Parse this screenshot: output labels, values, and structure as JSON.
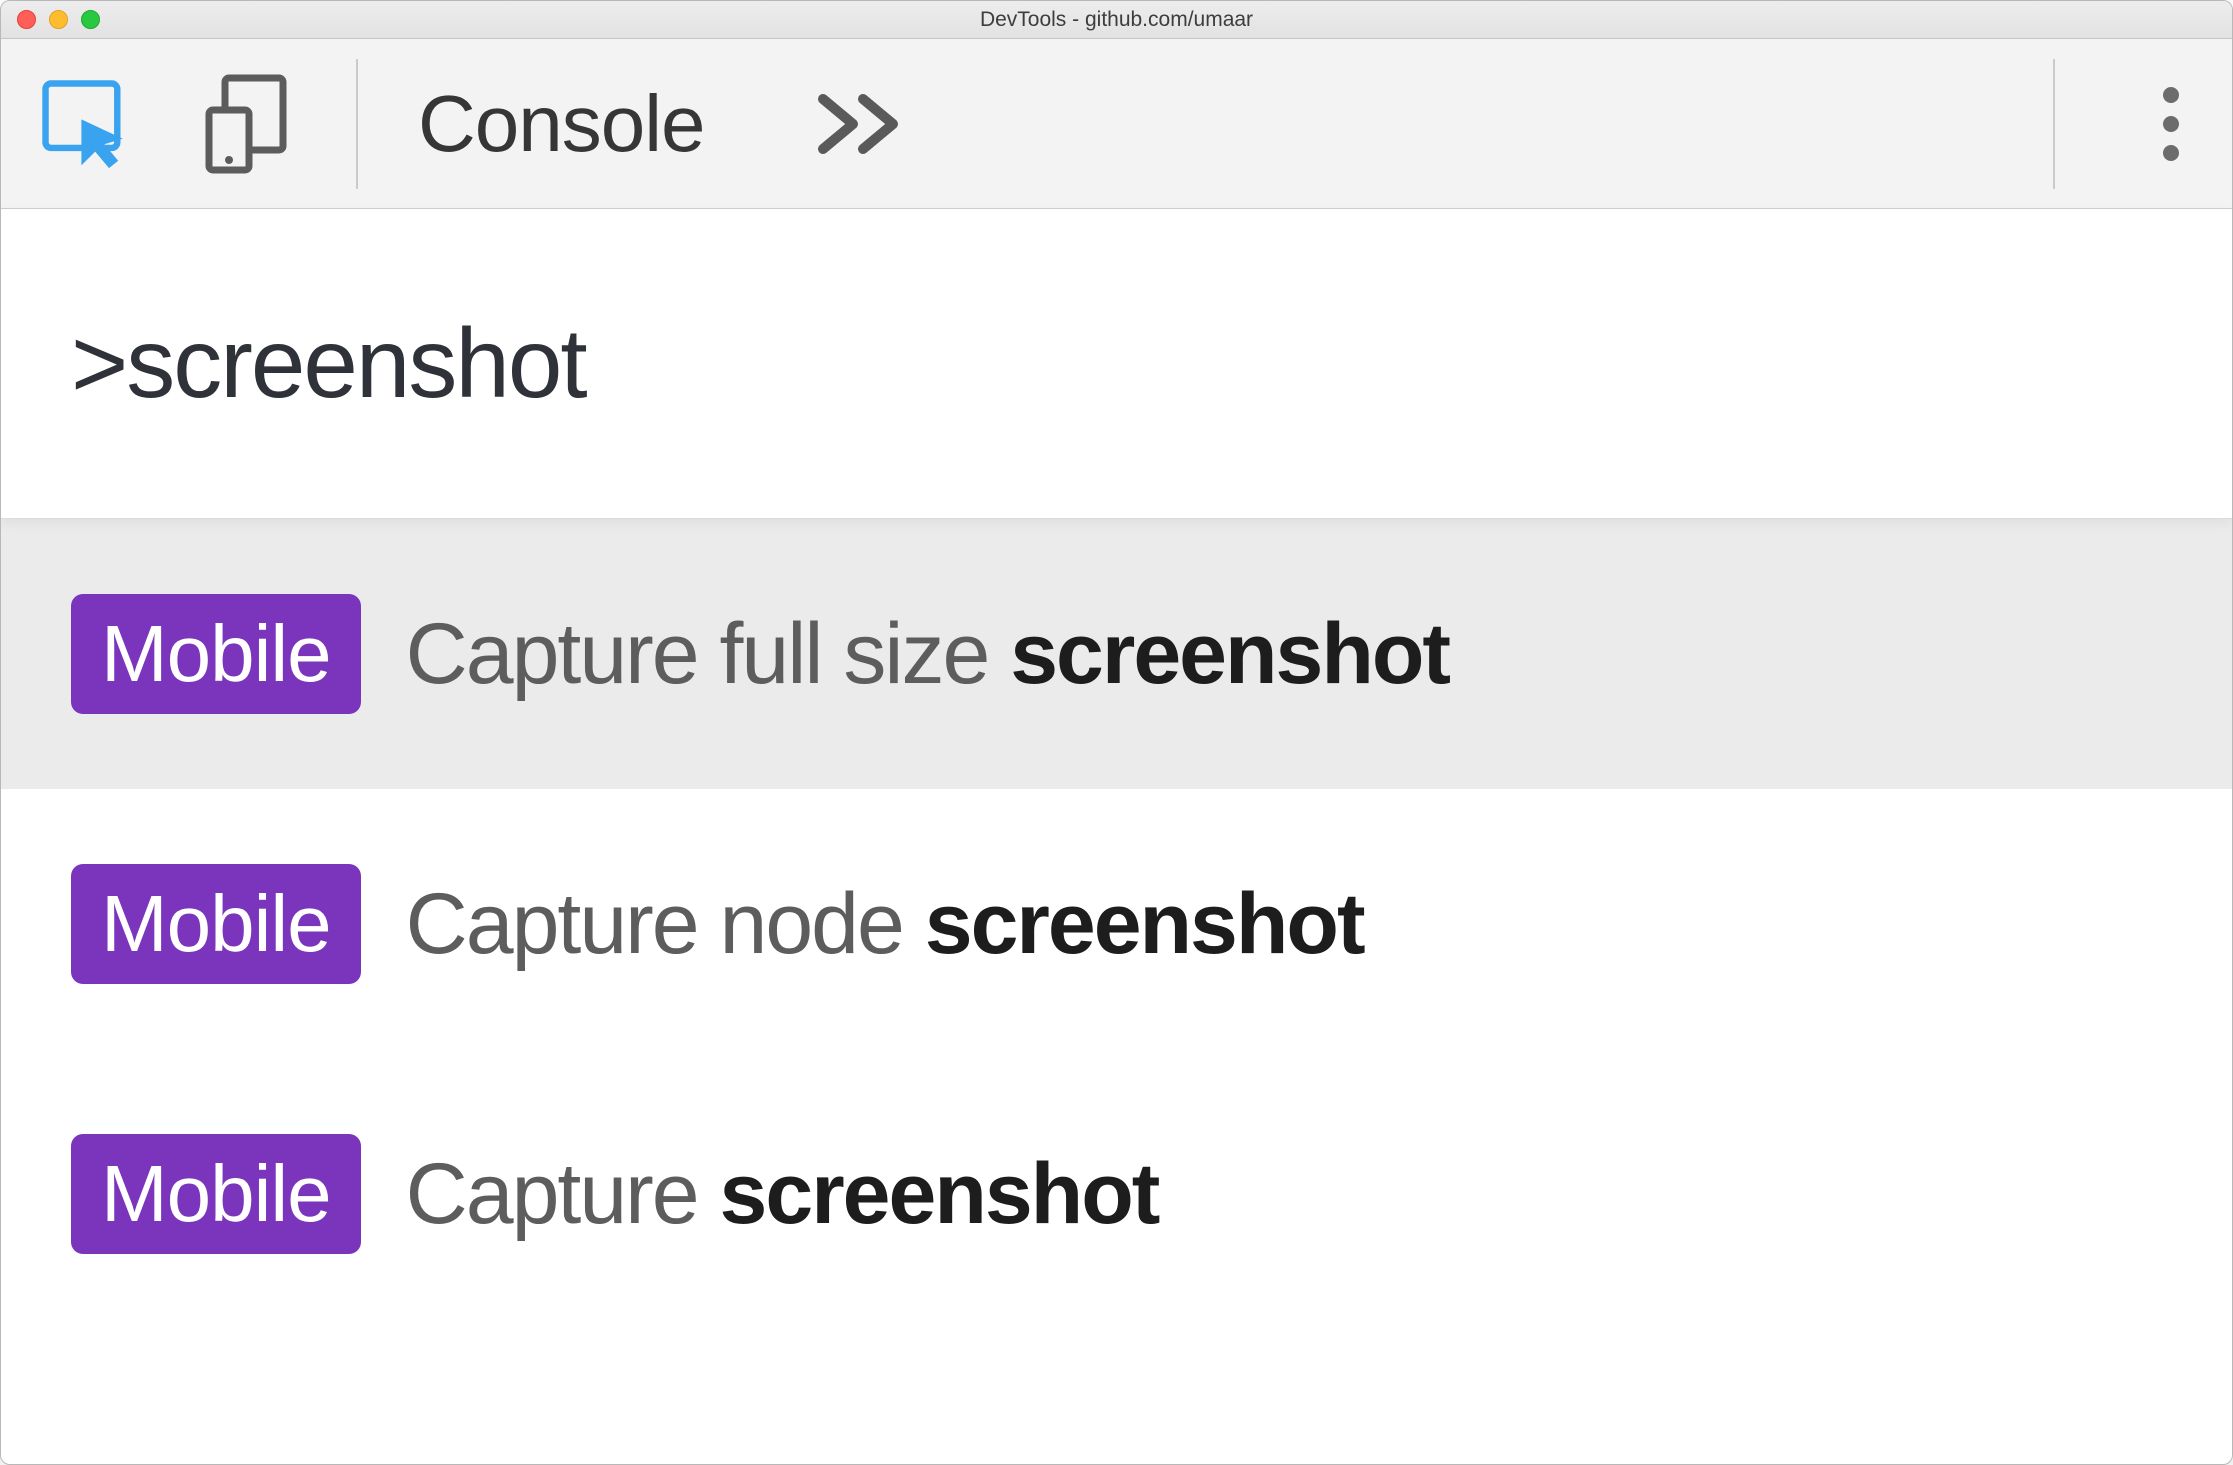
{
  "window": {
    "title": "DevTools - github.com/umaar"
  },
  "toolbar": {
    "tab_label": "Console"
  },
  "command": {
    "prompt": ">screenshot"
  },
  "badge_label": "Mobile",
  "results": [
    {
      "prefix": "Capture full size ",
      "match": "screenshot",
      "selected": true
    },
    {
      "prefix": "Capture node ",
      "match": "screenshot",
      "selected": false
    },
    {
      "prefix": "Capture ",
      "match": "screenshot",
      "selected": false
    }
  ],
  "colors": {
    "accent_purple": "#7b35bc",
    "inspect_blue": "#3aa3f0"
  }
}
